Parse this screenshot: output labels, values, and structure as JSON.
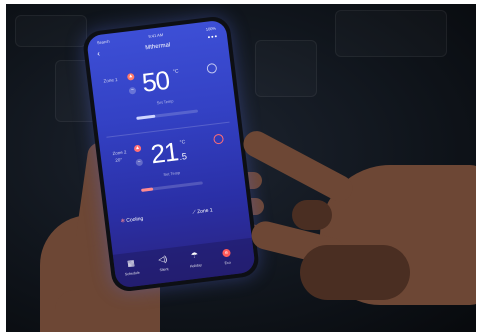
{
  "status_bar": {
    "carrier": "Search",
    "time": "9:41 AM",
    "battery": "100%"
  },
  "app": {
    "title": "Mthermal"
  },
  "zone1": {
    "label": "Zone 1",
    "mode_icon": "flame-icon",
    "temperature": "50",
    "unit": "°C",
    "set_temp_label": "Set Temp",
    "level": 0.3
  },
  "zone2": {
    "label": "Zone 2",
    "sub": "20°",
    "temperature": "21",
    "decimal": ".5",
    "unit": "°C",
    "set_temp_label": "Set Temp",
    "level": 0.2
  },
  "controls": {
    "mode_label": "Cooling",
    "zone_label": "Zone 1"
  },
  "tabs": [
    {
      "label": "Schedule",
      "icon": "calendar-icon"
    },
    {
      "label": "Silent",
      "icon": "speaker-icon"
    },
    {
      "label": "Holiday",
      "icon": "umbrella-icon"
    },
    {
      "label": "Eco",
      "icon": "eco-icon"
    }
  ],
  "colors": {
    "screen_top": "#3d4fd6",
    "screen_bottom": "#2a237f",
    "accent_red": "#ff6d75",
    "skin": "#6d4735"
  }
}
